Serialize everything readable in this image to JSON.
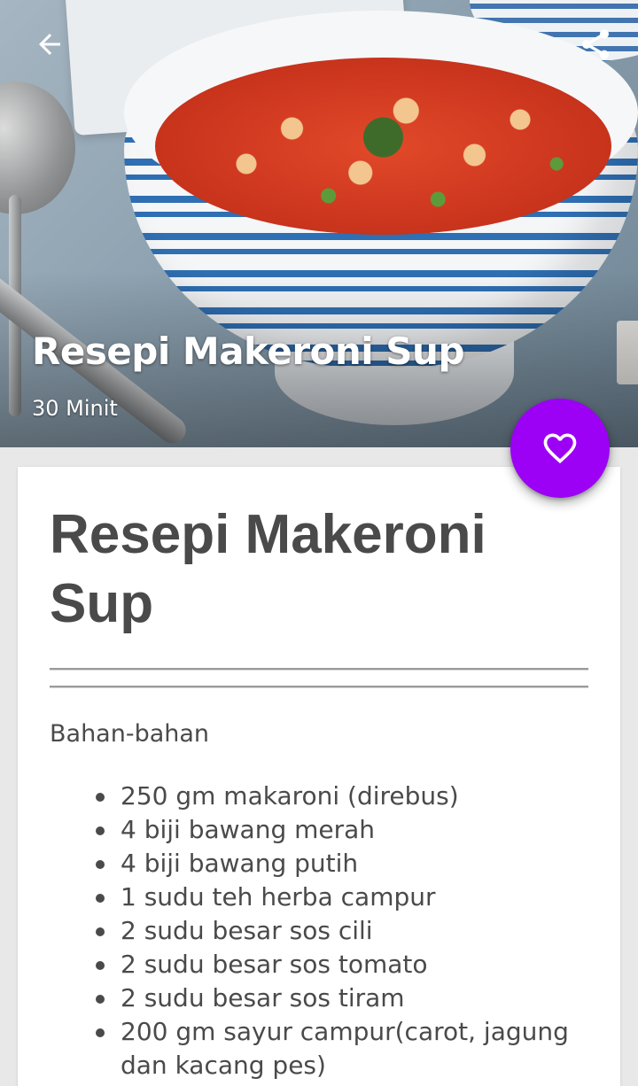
{
  "hero": {
    "title": "Resepi Makeroni Sup",
    "subtitle": "30 Minit"
  },
  "toolbar": {
    "back_icon": "arrow-back-icon",
    "share_icon": "share-icon"
  },
  "fab": {
    "icon": "heart-outline-icon",
    "color": "#9c00f5"
  },
  "card": {
    "title": "Resepi Makeroni Sup",
    "section_heading": "Bahan-bahan",
    "ingredients": [
      "250 gm makaroni (direbus)",
      "4 biji bawang merah",
      "4 biji bawang putih",
      "1 sudu teh herba campur",
      "2 sudu besar sos cili",
      "2 sudu besar sos tomato",
      "2 sudu besar sos tiram",
      "200 gm sayur campur(carot, jagung dan kacang pes)"
    ]
  }
}
